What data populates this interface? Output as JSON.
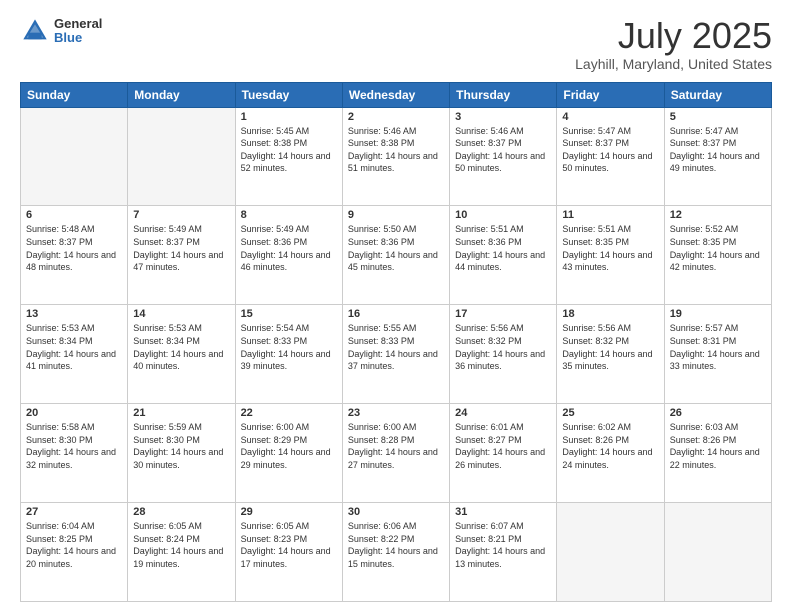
{
  "header": {
    "logo": {
      "line1": "General",
      "line2": "Blue"
    },
    "title": "July 2025",
    "subtitle": "Layhill, Maryland, United States"
  },
  "weekdays": [
    "Sunday",
    "Monday",
    "Tuesday",
    "Wednesday",
    "Thursday",
    "Friday",
    "Saturday"
  ],
  "weeks": [
    [
      {
        "day": "",
        "sunrise": "",
        "sunset": "",
        "daylight": ""
      },
      {
        "day": "",
        "sunrise": "",
        "sunset": "",
        "daylight": ""
      },
      {
        "day": "1",
        "sunrise": "Sunrise: 5:45 AM",
        "sunset": "Sunset: 8:38 PM",
        "daylight": "Daylight: 14 hours and 52 minutes."
      },
      {
        "day": "2",
        "sunrise": "Sunrise: 5:46 AM",
        "sunset": "Sunset: 8:38 PM",
        "daylight": "Daylight: 14 hours and 51 minutes."
      },
      {
        "day": "3",
        "sunrise": "Sunrise: 5:46 AM",
        "sunset": "Sunset: 8:37 PM",
        "daylight": "Daylight: 14 hours and 50 minutes."
      },
      {
        "day": "4",
        "sunrise": "Sunrise: 5:47 AM",
        "sunset": "Sunset: 8:37 PM",
        "daylight": "Daylight: 14 hours and 50 minutes."
      },
      {
        "day": "5",
        "sunrise": "Sunrise: 5:47 AM",
        "sunset": "Sunset: 8:37 PM",
        "daylight": "Daylight: 14 hours and 49 minutes."
      }
    ],
    [
      {
        "day": "6",
        "sunrise": "Sunrise: 5:48 AM",
        "sunset": "Sunset: 8:37 PM",
        "daylight": "Daylight: 14 hours and 48 minutes."
      },
      {
        "day": "7",
        "sunrise": "Sunrise: 5:49 AM",
        "sunset": "Sunset: 8:37 PM",
        "daylight": "Daylight: 14 hours and 47 minutes."
      },
      {
        "day": "8",
        "sunrise": "Sunrise: 5:49 AM",
        "sunset": "Sunset: 8:36 PM",
        "daylight": "Daylight: 14 hours and 46 minutes."
      },
      {
        "day": "9",
        "sunrise": "Sunrise: 5:50 AM",
        "sunset": "Sunset: 8:36 PM",
        "daylight": "Daylight: 14 hours and 45 minutes."
      },
      {
        "day": "10",
        "sunrise": "Sunrise: 5:51 AM",
        "sunset": "Sunset: 8:36 PM",
        "daylight": "Daylight: 14 hours and 44 minutes."
      },
      {
        "day": "11",
        "sunrise": "Sunrise: 5:51 AM",
        "sunset": "Sunset: 8:35 PM",
        "daylight": "Daylight: 14 hours and 43 minutes."
      },
      {
        "day": "12",
        "sunrise": "Sunrise: 5:52 AM",
        "sunset": "Sunset: 8:35 PM",
        "daylight": "Daylight: 14 hours and 42 minutes."
      }
    ],
    [
      {
        "day": "13",
        "sunrise": "Sunrise: 5:53 AM",
        "sunset": "Sunset: 8:34 PM",
        "daylight": "Daylight: 14 hours and 41 minutes."
      },
      {
        "day": "14",
        "sunrise": "Sunrise: 5:53 AM",
        "sunset": "Sunset: 8:34 PM",
        "daylight": "Daylight: 14 hours and 40 minutes."
      },
      {
        "day": "15",
        "sunrise": "Sunrise: 5:54 AM",
        "sunset": "Sunset: 8:33 PM",
        "daylight": "Daylight: 14 hours and 39 minutes."
      },
      {
        "day": "16",
        "sunrise": "Sunrise: 5:55 AM",
        "sunset": "Sunset: 8:33 PM",
        "daylight": "Daylight: 14 hours and 37 minutes."
      },
      {
        "day": "17",
        "sunrise": "Sunrise: 5:56 AM",
        "sunset": "Sunset: 8:32 PM",
        "daylight": "Daylight: 14 hours and 36 minutes."
      },
      {
        "day": "18",
        "sunrise": "Sunrise: 5:56 AM",
        "sunset": "Sunset: 8:32 PM",
        "daylight": "Daylight: 14 hours and 35 minutes."
      },
      {
        "day": "19",
        "sunrise": "Sunrise: 5:57 AM",
        "sunset": "Sunset: 8:31 PM",
        "daylight": "Daylight: 14 hours and 33 minutes."
      }
    ],
    [
      {
        "day": "20",
        "sunrise": "Sunrise: 5:58 AM",
        "sunset": "Sunset: 8:30 PM",
        "daylight": "Daylight: 14 hours and 32 minutes."
      },
      {
        "day": "21",
        "sunrise": "Sunrise: 5:59 AM",
        "sunset": "Sunset: 8:30 PM",
        "daylight": "Daylight: 14 hours and 30 minutes."
      },
      {
        "day": "22",
        "sunrise": "Sunrise: 6:00 AM",
        "sunset": "Sunset: 8:29 PM",
        "daylight": "Daylight: 14 hours and 29 minutes."
      },
      {
        "day": "23",
        "sunrise": "Sunrise: 6:00 AM",
        "sunset": "Sunset: 8:28 PM",
        "daylight": "Daylight: 14 hours and 27 minutes."
      },
      {
        "day": "24",
        "sunrise": "Sunrise: 6:01 AM",
        "sunset": "Sunset: 8:27 PM",
        "daylight": "Daylight: 14 hours and 26 minutes."
      },
      {
        "day": "25",
        "sunrise": "Sunrise: 6:02 AM",
        "sunset": "Sunset: 8:26 PM",
        "daylight": "Daylight: 14 hours and 24 minutes."
      },
      {
        "day": "26",
        "sunrise": "Sunrise: 6:03 AM",
        "sunset": "Sunset: 8:26 PM",
        "daylight": "Daylight: 14 hours and 22 minutes."
      }
    ],
    [
      {
        "day": "27",
        "sunrise": "Sunrise: 6:04 AM",
        "sunset": "Sunset: 8:25 PM",
        "daylight": "Daylight: 14 hours and 20 minutes."
      },
      {
        "day": "28",
        "sunrise": "Sunrise: 6:05 AM",
        "sunset": "Sunset: 8:24 PM",
        "daylight": "Daylight: 14 hours and 19 minutes."
      },
      {
        "day": "29",
        "sunrise": "Sunrise: 6:05 AM",
        "sunset": "Sunset: 8:23 PM",
        "daylight": "Daylight: 14 hours and 17 minutes."
      },
      {
        "day": "30",
        "sunrise": "Sunrise: 6:06 AM",
        "sunset": "Sunset: 8:22 PM",
        "daylight": "Daylight: 14 hours and 15 minutes."
      },
      {
        "day": "31",
        "sunrise": "Sunrise: 6:07 AM",
        "sunset": "Sunset: 8:21 PM",
        "daylight": "Daylight: 14 hours and 13 minutes."
      },
      {
        "day": "",
        "sunrise": "",
        "sunset": "",
        "daylight": ""
      },
      {
        "day": "",
        "sunrise": "",
        "sunset": "",
        "daylight": ""
      }
    ]
  ]
}
